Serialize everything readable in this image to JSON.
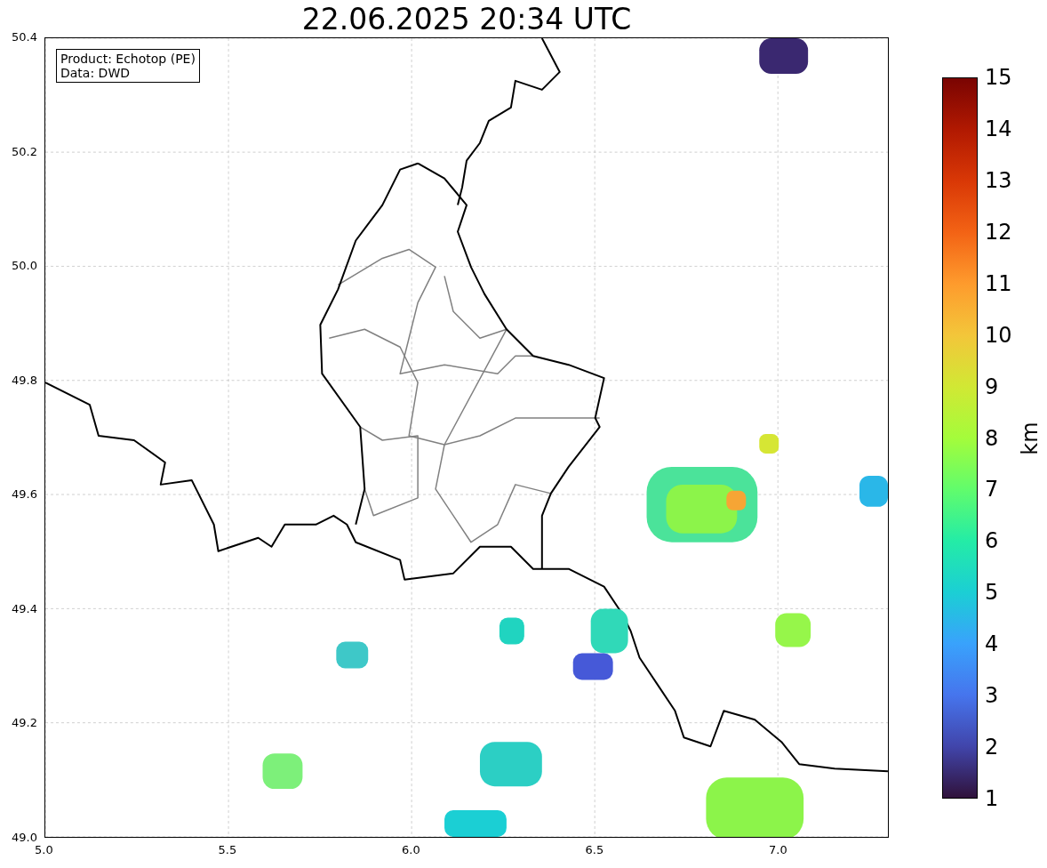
{
  "title": "22.06.2025 20:34 UTC",
  "info_box": [
    "Product: Echotop (PE)",
    "Data: DWD"
  ],
  "map": {
    "xticks": [
      "5.0",
      "5.5",
      "6.0",
      "6.5",
      "7.0"
    ],
    "yticks": [
      "50.4",
      "50.2",
      "50.0",
      "49.8",
      "49.6",
      "49.4",
      "49.2",
      "49.0"
    ]
  },
  "colorbar": {
    "label": "km",
    "ticks": [
      "15",
      "14",
      "13",
      "12",
      "11",
      "10",
      "9",
      "8",
      "7",
      "6",
      "5",
      "4",
      "3",
      "2",
      "1"
    ]
  }
}
